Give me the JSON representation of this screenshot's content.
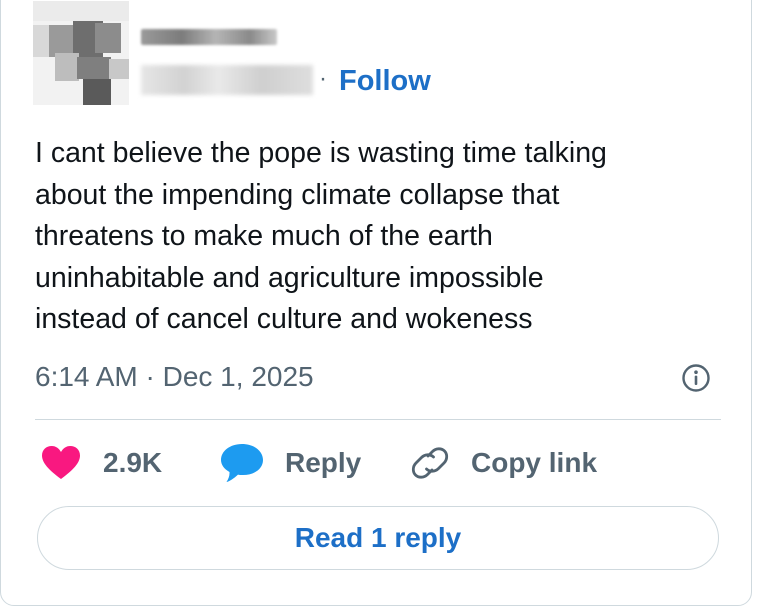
{
  "header": {
    "separator": "·",
    "follow_label": "Follow"
  },
  "tweet": {
    "lines": [
      "I cant believe the pope is wasting time talking",
      "about the impending climate collapse that",
      "threatens to make much of the earth",
      "uninhabitable and agriculture impossible",
      "instead of cancel culture and wokeness"
    ],
    "timestamp": "6:14 AM · Dec 1, 2025"
  },
  "actions": {
    "like_count": "2.9K",
    "reply_label": "Reply",
    "copy_link_label": "Copy link"
  },
  "read_replies_label": "Read 1 reply",
  "colors": {
    "accent": "#1d6fc7",
    "like": "#f91880",
    "reply_icon": "#1d9bf0",
    "muted": "#536471",
    "text": "#0f1419",
    "border": "#cfd9de"
  },
  "icons": {
    "like": "heart-icon",
    "reply": "speech-bubble-icon",
    "copy_link": "link-icon",
    "info": "info-icon"
  }
}
